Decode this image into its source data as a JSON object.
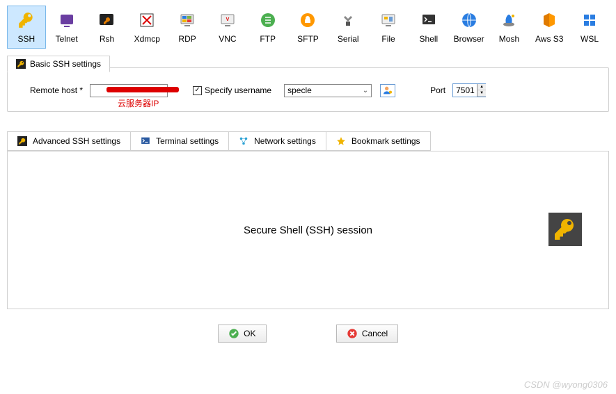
{
  "toolbar": {
    "items": [
      {
        "label": "SSH",
        "icon": "key-icon",
        "active": true
      },
      {
        "label": "Telnet",
        "icon": "telnet-icon"
      },
      {
        "label": "Rsh",
        "icon": "rsh-icon"
      },
      {
        "label": "Xdmcp",
        "icon": "xdmcp-icon"
      },
      {
        "label": "RDP",
        "icon": "rdp-icon"
      },
      {
        "label": "VNC",
        "icon": "vnc-icon"
      },
      {
        "label": "FTP",
        "icon": "ftp-icon"
      },
      {
        "label": "SFTP",
        "icon": "sftp-icon"
      },
      {
        "label": "Serial",
        "icon": "serial-icon"
      },
      {
        "label": "File",
        "icon": "file-icon"
      },
      {
        "label": "Shell",
        "icon": "shell-icon"
      },
      {
        "label": "Browser",
        "icon": "browser-icon"
      },
      {
        "label": "Mosh",
        "icon": "mosh-icon"
      },
      {
        "label": "Aws S3",
        "icon": "aws-icon"
      },
      {
        "label": "WSL",
        "icon": "wsl-icon"
      }
    ]
  },
  "basic_section": {
    "title": "Basic SSH settings",
    "remote_host_label": "Remote host *",
    "remote_host_value": "",
    "annotation": "云服务器IP",
    "specify_username_label": "Specify username",
    "specify_username_checked": true,
    "username_value": "specle",
    "port_label": "Port",
    "port_value": "7501"
  },
  "tabs": [
    {
      "label": "Advanced SSH settings",
      "icon": "tool-icon"
    },
    {
      "label": "Terminal settings",
      "icon": "terminal-icon"
    },
    {
      "label": "Network settings",
      "icon": "network-icon"
    },
    {
      "label": "Bookmark settings",
      "icon": "star-icon"
    }
  ],
  "panel": {
    "title": "Secure Shell (SSH) session"
  },
  "buttons": {
    "ok": "OK",
    "cancel": "Cancel"
  },
  "watermark": "CSDN @wyong0306"
}
